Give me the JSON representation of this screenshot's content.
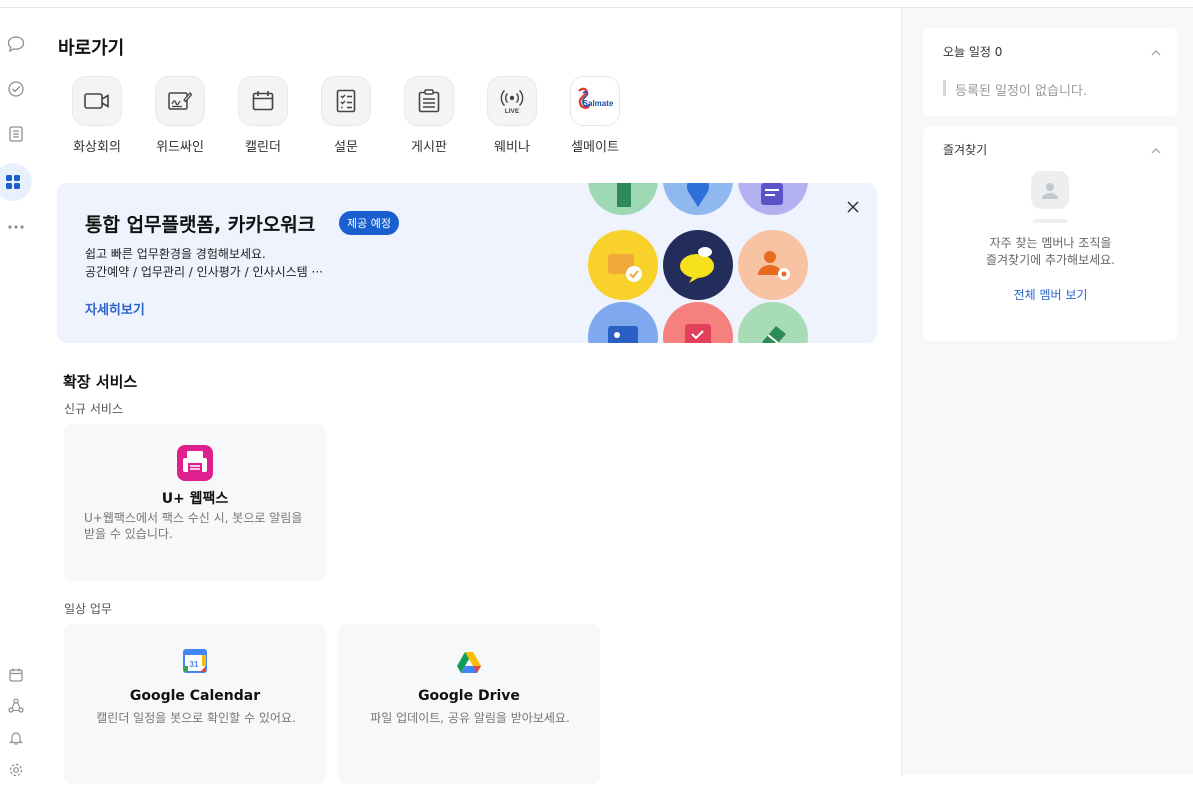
{
  "shortcuts": {
    "title": "바로가기",
    "items": [
      {
        "label": "화상회의",
        "icon": "video-camera-icon"
      },
      {
        "label": "위드싸인",
        "icon": "signature-icon"
      },
      {
        "label": "캘린더",
        "icon": "calendar-icon"
      },
      {
        "label": "설문",
        "icon": "survey-icon"
      },
      {
        "label": "게시판",
        "icon": "board-icon"
      },
      {
        "label": "웨비나",
        "icon": "live-broadcast-icon"
      },
      {
        "label": "셀메이트",
        "icon": "salmate-logo-icon"
      }
    ]
  },
  "banner": {
    "title": "통합 업무플랫폼, 카카오워크",
    "badge": "제공 예정",
    "desc_line1": "쉽고 빠른 업무환경을 경험해보세요.",
    "desc_line2": "공간예약 / 업무관리 / 인사평가 / 인사시스템 ···",
    "link": "자세히보기"
  },
  "extensions": {
    "title": "확장 서비스",
    "new_label": "신규 서비스",
    "new_cards": [
      {
        "name": "U+ 웹팩스",
        "desc": "U+웹팩스에서 팩스 수신 시, 봇으로 알림을 받을 수 있습니다.",
        "icon": "fax-icon"
      }
    ],
    "daily_label": "일상 업무",
    "daily_cards": [
      {
        "name": "Google Calendar",
        "desc": "캘린더 일정을 봇으로 확인할 수 있어요.",
        "icon": "google-calendar-icon",
        "icon_text": "31"
      },
      {
        "name": "Google Drive",
        "desc": "파일 업데이트, 공유 알림을 받아보세요.",
        "icon": "google-drive-icon"
      }
    ]
  },
  "right": {
    "today": {
      "title": "오늘 일정 0",
      "empty": "등록된 일정이 없습니다."
    },
    "favorites": {
      "title": "즐겨찾기",
      "desc_line1": "자주 찾는 멤버나 조직을",
      "desc_line2": "즐겨찾기에 추가해보세요.",
      "link": "전체 멤버 보기"
    }
  },
  "colors": {
    "accent": "#1a5fd0",
    "link": "#2a64c9",
    "banner_bg": "#eef3fd"
  }
}
